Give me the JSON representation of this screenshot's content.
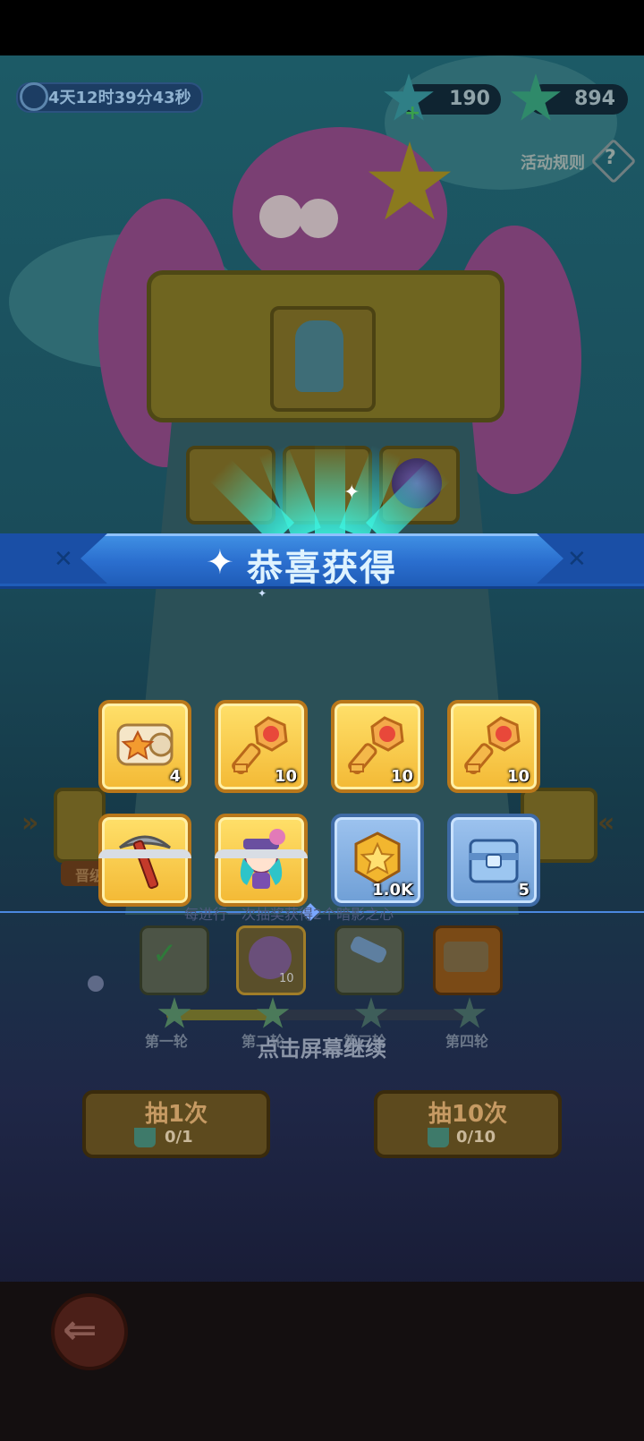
{
  "header": {
    "timer_text": "4天12时39分43秒",
    "currency_1": "190",
    "currency_2": "894",
    "rules_label": "活动规则",
    "rules_icon_glyph": "?"
  },
  "banner": {
    "title": "恭喜获得",
    "sparkle_glyph": "✦"
  },
  "rewards": [
    {
      "icon": "scroll-icon",
      "count": "4",
      "frame": "gold"
    },
    {
      "icon": "key-icon",
      "count": "10",
      "frame": "gold"
    },
    {
      "icon": "key-icon",
      "count": "10",
      "frame": "gold"
    },
    {
      "icon": "key-icon",
      "count": "10",
      "frame": "gold"
    },
    {
      "icon": "pickaxe-icon",
      "count": "",
      "frame": "gold"
    },
    {
      "icon": "character-icon",
      "count": "",
      "frame": "gold"
    },
    {
      "icon": "coin-icon",
      "count": "1.0K",
      "frame": "blue"
    },
    {
      "icon": "chest-icon",
      "count": "5",
      "frame": "blue"
    }
  ],
  "progress": {
    "hint_text": "每进行一次抽奖获得2个暗影之心",
    "rounds": [
      "第一轮",
      "第二轮",
      "第三轮",
      "第四轮"
    ],
    "stage_count": "10"
  },
  "continue_text": "点击屏幕继续",
  "draw": {
    "single_label": "抽1次",
    "single_count": "0/1",
    "ten_label": "抽10次",
    "ten_count": "0/10"
  },
  "background": {
    "tag_label": "晋级"
  },
  "colors": {
    "banner_blue": "#2b6fcf",
    "gold_frame": "#f3b935",
    "blue_frame": "#6f9fd6",
    "ray_cyan": "#3cf0dc"
  }
}
